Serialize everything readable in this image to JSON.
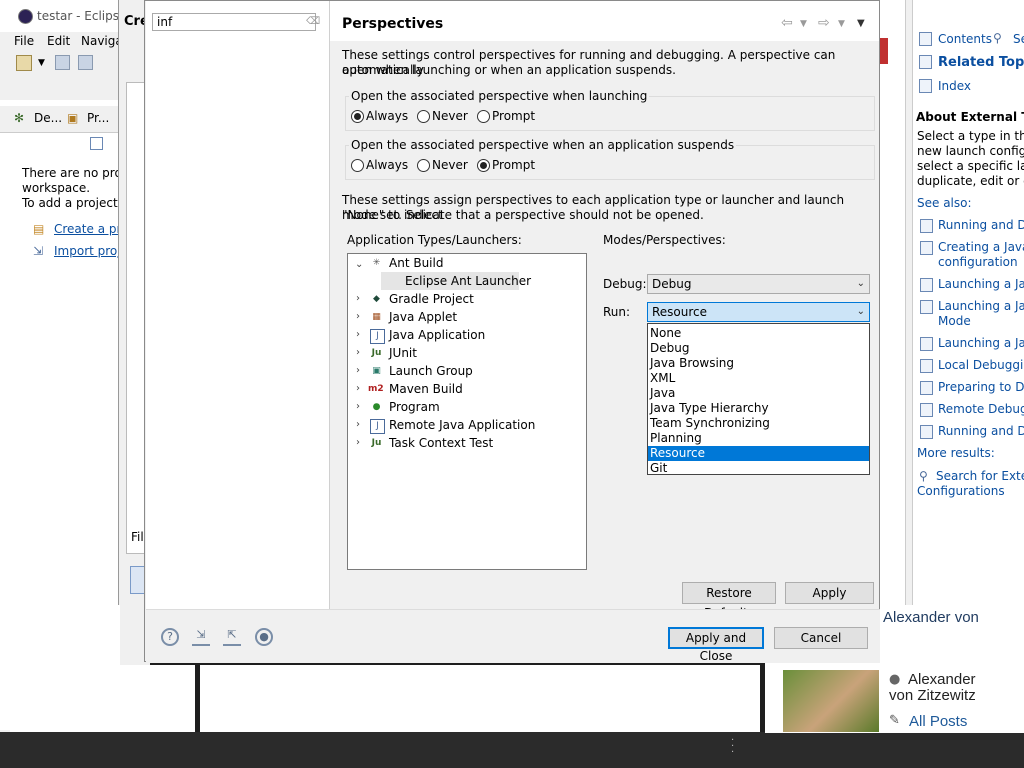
{
  "window": {
    "title": "testar - Eclipse I"
  },
  "menubar": {
    "items": [
      "File",
      "Edit",
      "Navigat"
    ]
  },
  "left_view": {
    "tabs": [
      "De...",
      "Pr..."
    ],
    "message_line1": "There are no projec",
    "message_line2": "workspace.",
    "message_line3": "To add a project:",
    "link_create": "Create a proj",
    "link_import": "Import proje",
    "filter_label": "Filt"
  },
  "create_dialog": {
    "title_fragment": "Cre"
  },
  "preferences": {
    "filter_value": "inf",
    "page_title": "Perspectives",
    "intro_text_line1": "These settings control perspectives for running and debugging. A perspective can automatically",
    "intro_text_line2": "open when launching or when an application suspends.",
    "launch_group": {
      "label": "Open the associated perspective when launching",
      "options": [
        "Always",
        "Never",
        "Prompt"
      ],
      "selected": "Always"
    },
    "suspend_group": {
      "label": "Open the associated perspective when an application suspends",
      "options": [
        "Always",
        "Never",
        "Prompt"
      ],
      "selected": "Prompt"
    },
    "assign_text_line1": "These settings assign perspectives to each application type or launcher and launch mode set. Select",
    "assign_text_line2": "\"None\" to indicate that a perspective should not be opened.",
    "types_label": "Application Types/Launchers:",
    "modes_label": "Modes/Perspectives:",
    "launchers": [
      {
        "label": "Ant Build",
        "expanded": true,
        "icon": "ant-icon"
      },
      {
        "label": "Eclipse Ant Launcher",
        "child": true,
        "selected": true
      },
      {
        "label": "Gradle Project",
        "icon": "gradle-icon"
      },
      {
        "label": "Java Applet",
        "icon": "applet-icon"
      },
      {
        "label": "Java Application",
        "icon": "java-app-icon"
      },
      {
        "label": "JUnit",
        "icon": "junit-icon"
      },
      {
        "label": "Launch Group",
        "icon": "launch-group-icon"
      },
      {
        "label": "Maven Build",
        "icon": "maven-icon"
      },
      {
        "label": "Program",
        "icon": "program-icon"
      },
      {
        "label": "Remote Java Application",
        "icon": "remote-java-icon"
      },
      {
        "label": "Task Context Test",
        "icon": "task-context-icon"
      }
    ],
    "debug_label": "Debug:",
    "debug_value": "Debug",
    "run_label": "Run:",
    "run_value": "Resource",
    "run_options": [
      "None",
      "Debug",
      "Java Browsing",
      "XML",
      "Java",
      "Java Type Hierarchy",
      "Team Synchronizing",
      "Planning",
      "Resource",
      "Git"
    ],
    "run_selected": "Resource",
    "restore_defaults": "Restore Defaults",
    "apply": "Apply",
    "apply_and_close": "Apply and Close",
    "cancel": "Cancel"
  },
  "help": {
    "contents": "Contents",
    "search_fragment": "Se",
    "related_topics": "Related Topics",
    "index": "Index",
    "about_title": "About External Tool",
    "about_line1": "Select a type in this t",
    "about_line2": "new launch configur",
    "about_line3": "select a specific laun",
    "about_line4": "duplicate, edit or del",
    "see_also": "See also:",
    "links": [
      "Running and De",
      "Creating a Java a",
      "configuration",
      "Launching a Java",
      "Launching a Java",
      "Mode",
      "Launching a Java",
      "Local Debugging",
      "Preparing to Deb",
      "Remote Debugg",
      "Running and De"
    ],
    "more_results": "More results:",
    "search_external": "Search for Extern",
    "configurations": "Configurations"
  },
  "blog": {
    "author_heading": "Alexander von",
    "author_name_line1": "Alexander",
    "author_name_line2": "von Zitzewitz",
    "all_posts": "All Posts"
  }
}
